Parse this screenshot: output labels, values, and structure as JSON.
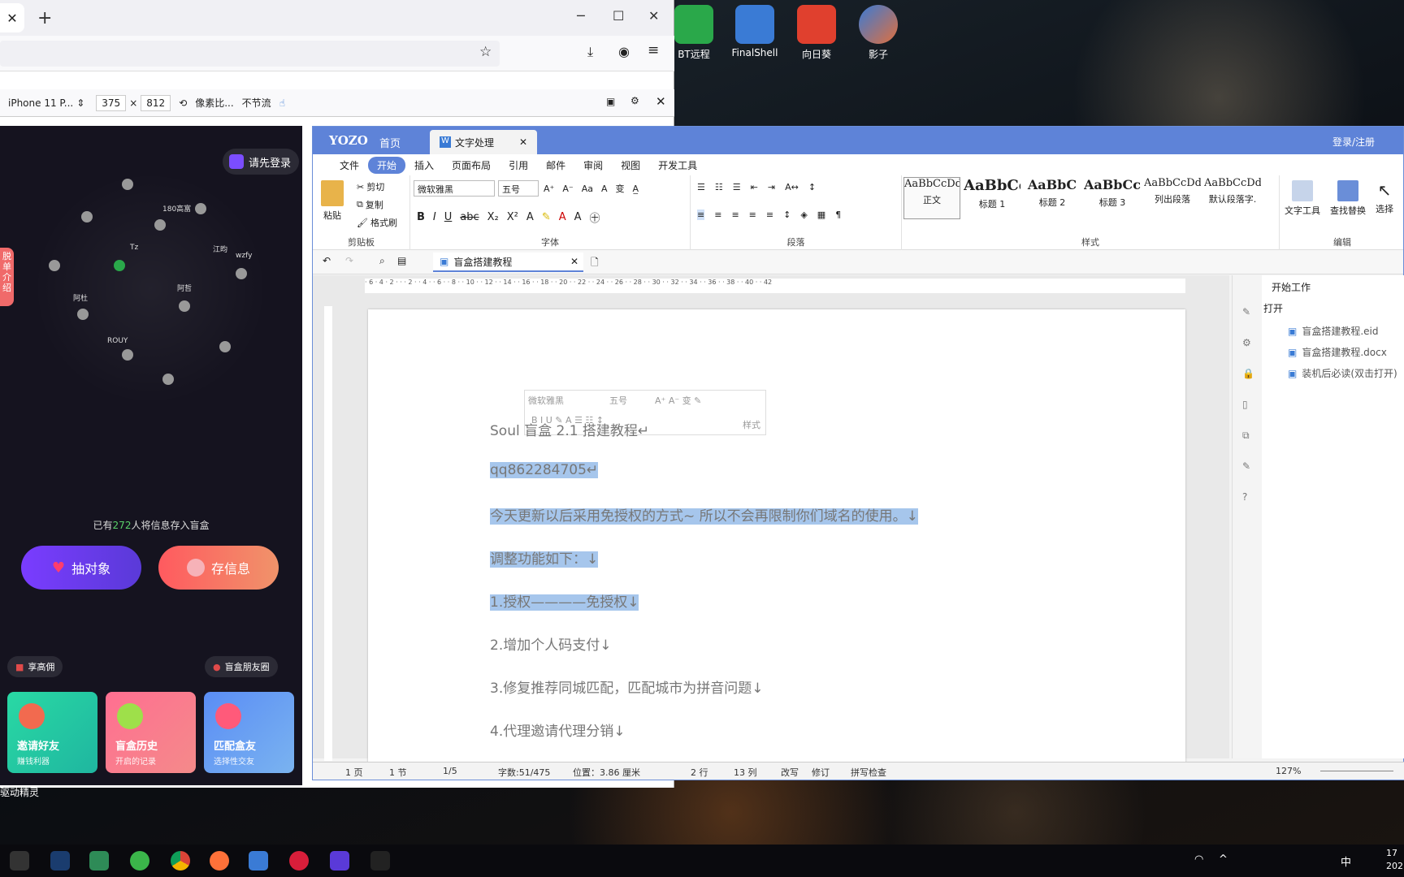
{
  "desktop": {
    "icons": [
      {
        "label": "BT远程",
        "icon": "bt-remote-icon",
        "color": "#2aa84a"
      },
      {
        "label": "FinalShell",
        "icon": "finalshell-icon",
        "color": "#3a7bd5"
      },
      {
        "label": "向日葵",
        "icon": "sunlogin-icon",
        "color": "#e0402e"
      },
      {
        "label": "影子",
        "icon": "shadow-app-icon",
        "color": "#e06f3e"
      }
    ],
    "bottom_text": "驱动精灵"
  },
  "browser": {
    "tab_close": "✕",
    "new_tab": "+",
    "devtools": {
      "device": "iPhone 11 P...",
      "width": "375",
      "times": "×",
      "height": "812",
      "dpr": "像素比...",
      "throttle": "不节流"
    }
  },
  "phone_app": {
    "login_label": "请先登录",
    "side_tab": "脱单介绍",
    "sphere_names": [
      "180高富",
      "江昀",
      "Tz",
      "阿哲",
      "ROUY",
      "阿杜",
      "wzfy"
    ],
    "count_prefix": "已有",
    "count_value": "272",
    "count_suffix": "人将信息存入盲盒",
    "draw_button": "抽对象",
    "store_button": "存信息",
    "pill_left": "享高佣",
    "pill_right": "盲盒朋友圈",
    "cards": [
      {
        "title": "邀请好友",
        "sub": "赚钱利器"
      },
      {
        "title": "盲盒历史",
        "sub": "开启的记录"
      },
      {
        "title": "匹配盒友",
        "sub": "选择性交友"
      }
    ]
  },
  "yozo": {
    "brand": "YOZO",
    "home_tab": "首页",
    "doc_app_tab": "文字处理",
    "login": "登录/注册",
    "menu": [
      "文件",
      "开始",
      "插入",
      "页面布局",
      "引用",
      "邮件",
      "审阅",
      "视图",
      "开发工具"
    ],
    "clipboard": {
      "paste": "粘贴",
      "cut": "剪切",
      "copy": "复制",
      "format": "格式刷",
      "label": "剪贴板"
    },
    "font": {
      "name": "微软雅黑",
      "size": "五号",
      "label": "字体"
    },
    "paragraph_label": "段落",
    "styles": [
      {
        "preview": "AaBbCcDd",
        "name": "正文"
      },
      {
        "preview": "AaBbCc",
        "name": "标题 1"
      },
      {
        "preview": "AaBbC",
        "name": "标题 2"
      },
      {
        "preview": "AaBbCcI",
        "name": "标题 3"
      },
      {
        "preview": "AaBbCcDd",
        "name": "列出段落"
      },
      {
        "preview": "AaBbCcDd",
        "name": "默认段落字."
      }
    ],
    "styles_label": "样式",
    "edit": {
      "text_tools": "文字工具",
      "find_replace": "查找替换",
      "select": "选择",
      "label": "编辑"
    },
    "doc_tab": "盲盒搭建教程",
    "ruler_marks": "· 6 · 4 · 2 · · · 2 · · 4 · · 6 · · 8 · · 10 · · 12 · · 14 · · 16 · · 18 · · 20 · · 22 · · 24 · · 26 · · 28 · · 30 · · 32 · · 34 · · 36 · · 38 · · 40 · · 42",
    "mini_toolbar": {
      "font": "微软雅黑",
      "size": "五号",
      "style": "样式"
    },
    "paragraphs": [
      "Soul 盲盒 2.1 搭建教程↵",
      "qq862284705↵",
      "今天更新以后采用免授权的方式~  所以不会再限制你们域名的使用。↓",
      "调整功能如下：↓",
      "1.授权————免授权↓",
      "2.增加个人码支付↓",
      "3.修复推荐同城匹配，匹配城市为拼音问题↓",
      "4.代理邀请代理分销↓"
    ],
    "side_pane": {
      "title": "开始工作",
      "open": "打开",
      "files": [
        "盲盒搭建教程.eid",
        "盲盒搭建教程.docx",
        "装机后必读(双击打开)"
      ]
    },
    "status": {
      "page": "1 页",
      "section": "1 节",
      "pages": "1/5",
      "words": "字数:51/475",
      "position": "位置：3.86 厘米",
      "row": "2 行",
      "col": "13 列",
      "overwrite": "改写",
      "revise": "修订",
      "spell": "拼写检查",
      "zoom": "127%"
    }
  },
  "taskbar": {
    "ime": "中",
    "time": "17",
    "date": "202"
  }
}
